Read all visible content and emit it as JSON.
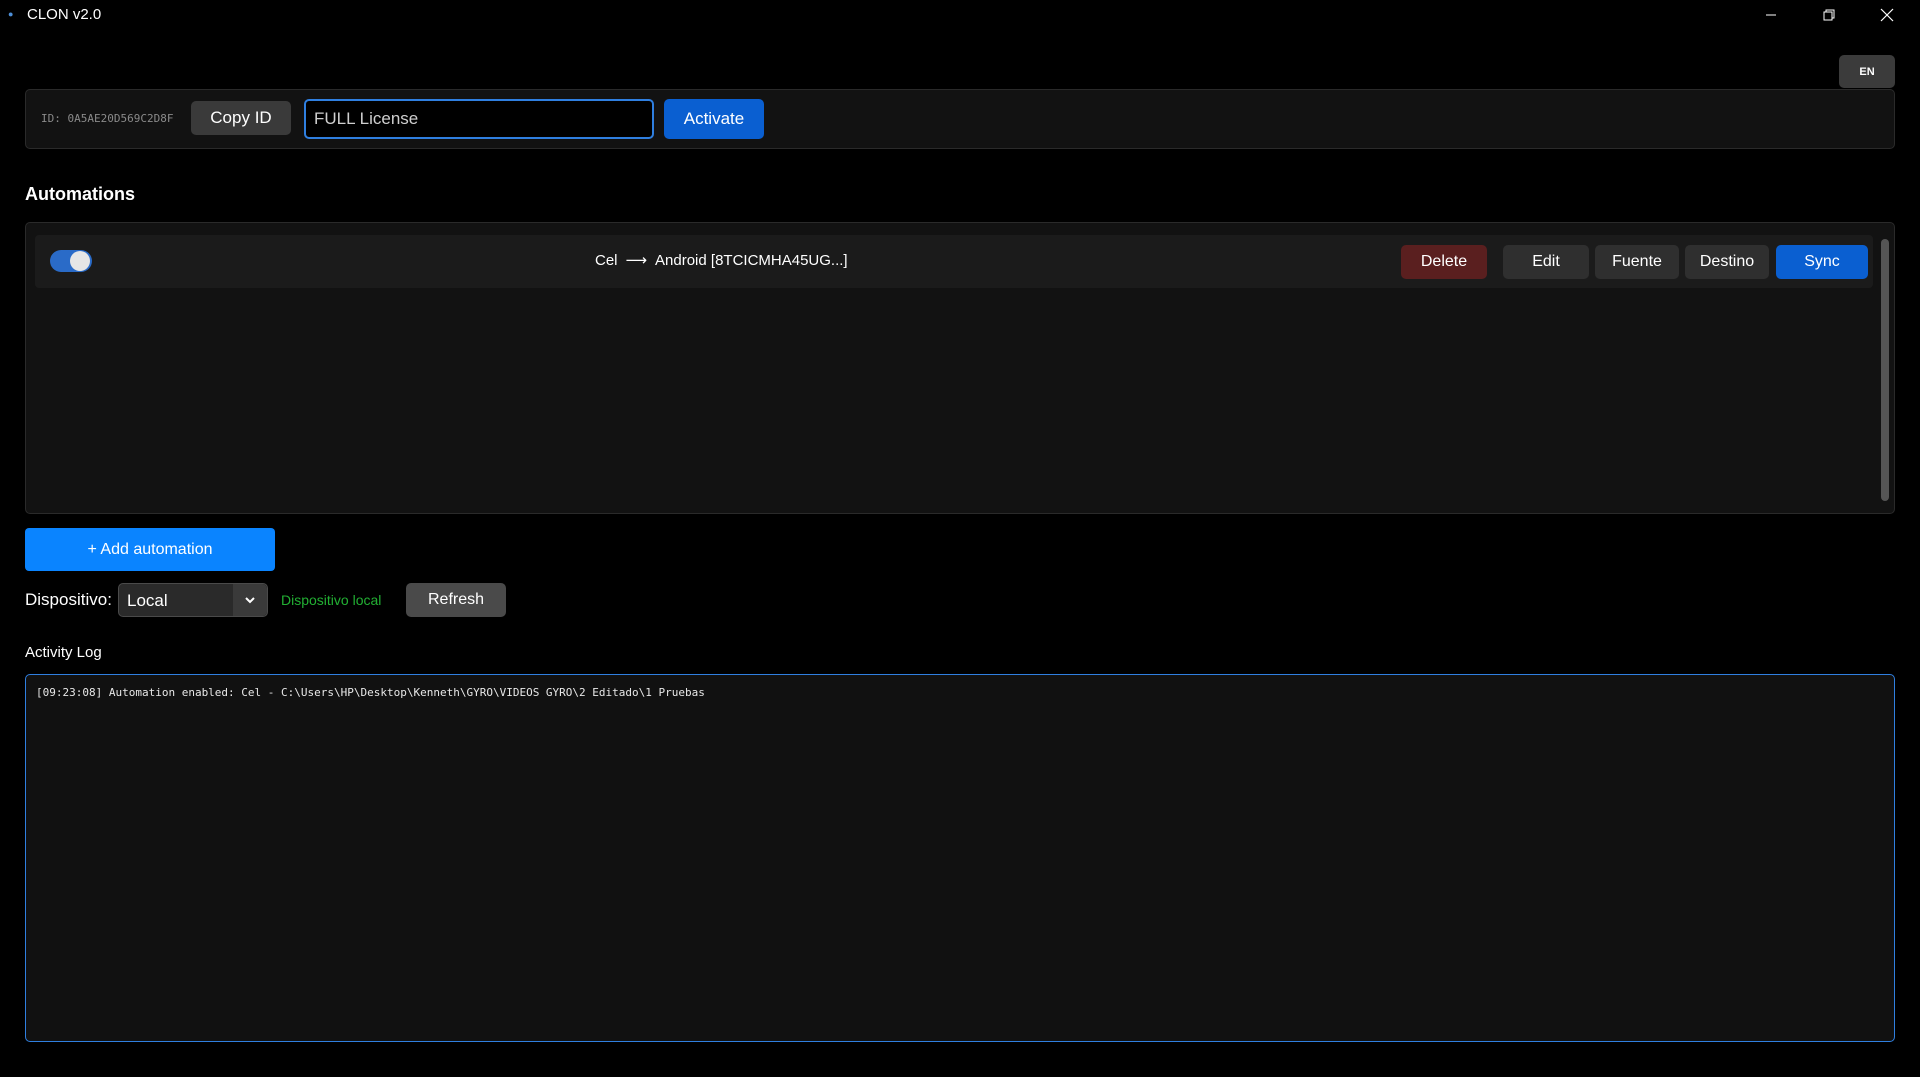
{
  "window": {
    "title": "CLON v2.0",
    "app_icon": "app-dot-icon"
  },
  "lang": {
    "label": "EN"
  },
  "license": {
    "machine_id": "ID: 0A5AE20D569C2D8F",
    "copy_label": "Copy ID",
    "input_value": "FULL License",
    "activate_label": "Activate"
  },
  "automations": {
    "title": "Automations",
    "items": [
      {
        "enabled": true,
        "source": "Cel",
        "arrow": "⟶",
        "target": "Android [8TCICMHA45UG...]",
        "delete_label": "Delete",
        "edit_label": "Edit",
        "fuente_label": "Fuente",
        "destino_label": "Destino",
        "sync_label": "Sync"
      }
    ],
    "add_label": "+ Add automation"
  },
  "device": {
    "label": "Dispositivo:",
    "selected": "Local",
    "status": "Dispositivo local",
    "refresh_label": "Refresh"
  },
  "log": {
    "title": "Activity Log",
    "lines": [
      "[09:23:08] Automation enabled: Cel - C:\\Users\\HP\\Desktop\\Kenneth\\GYRO\\VIDEOS GYRO\\2 Editado\\1 Pruebas"
    ]
  },
  "colors": {
    "accent": "#0a84ff",
    "primary_button": "#0a5fd1",
    "delete_button": "#5a1f1f",
    "status_ok": "#22b033",
    "focus_border": "#2f7fe0"
  }
}
